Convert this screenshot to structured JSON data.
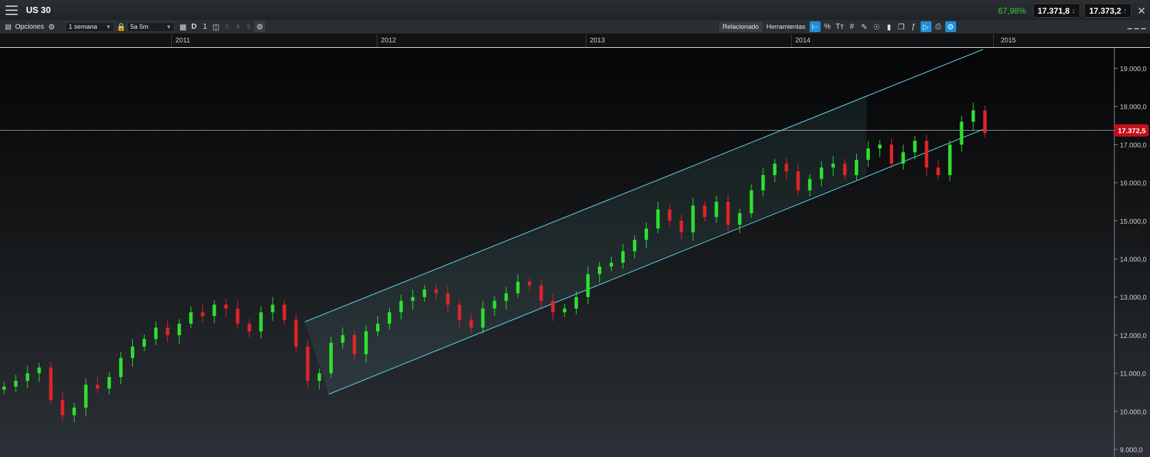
{
  "header": {
    "title": "US 30",
    "change_pct": "67,98%",
    "sell_price": "17.371,8",
    "buy_price": "17.373,2"
  },
  "toolbar": {
    "options_label": "Opciones",
    "interval_value": "1 semana",
    "range_value": "5a 5m",
    "d_label": "D",
    "one_label": "1",
    "n3": "3",
    "n4": "4",
    "n5": "5",
    "related_label": "Relacionado",
    "tools_label": "Herramientas",
    "percent_label": "%"
  },
  "time_axis": {
    "years": [
      "2011",
      "2012",
      "2013",
      "2014",
      "2015"
    ]
  },
  "price_axis": {
    "ticks": [
      "19.000,0",
      "18.000,0",
      "17.000,0",
      "16.000,0",
      "15.000,0",
      "14.000,0",
      "13.000,0",
      "12.000,0",
      "11.000,0",
      "10.000,0",
      "9.000,0"
    ],
    "current_price_label": "17.372,5"
  },
  "colors": {
    "up_candle": "#2fe02f",
    "down_candle": "#e0242a",
    "channel": "#59c6dc",
    "price_tag": "#c40e1a",
    "accent_active": "#1e8fd6"
  },
  "chart_data": {
    "type": "candlestick",
    "instrument": "US 30",
    "interval": "1 semana",
    "ylim": [
      9000,
      19500
    ],
    "current_price": 17372.5,
    "closes_approx": [
      10650,
      10800,
      11000,
      11150,
      10300,
      9900,
      10100,
      10700,
      10600,
      10900,
      11400,
      11700,
      11900,
      12200,
      12000,
      12300,
      12600,
      12500,
      12800,
      12700,
      12300,
      12100,
      12600,
      12800,
      12400,
      11700,
      10800,
      11000,
      11800,
      12000,
      11500,
      12100,
      12300,
      12600,
      12900,
      13000,
      13200,
      13100,
      12800,
      12400,
      12200,
      12700,
      12900,
      13100,
      13400,
      13300,
      12900,
      12600,
      12700,
      13000,
      13600,
      13800,
      13900,
      14200,
      14500,
      14800,
      15300,
      15000,
      14700,
      15400,
      15100,
      15500,
      14900,
      15200,
      15800,
      16200,
      16500,
      16300,
      15800,
      16100,
      16400,
      16500,
      16200,
      16600,
      16900,
      17000,
      16500,
      16800,
      17100,
      16400,
      16200,
      17000,
      17600,
      17900,
      17300
    ],
    "trend_channel": {
      "upper_line": [
        {
          "year": 2011.65,
          "value": 12350
        },
        {
          "year": 2014.95,
          "value": 19500
        }
      ],
      "lower_line": [
        {
          "year": 2011.65,
          "value": 10450
        },
        {
          "year": 2014.95,
          "value": 17400
        }
      ]
    },
    "horizontal_line": 17372.5
  }
}
